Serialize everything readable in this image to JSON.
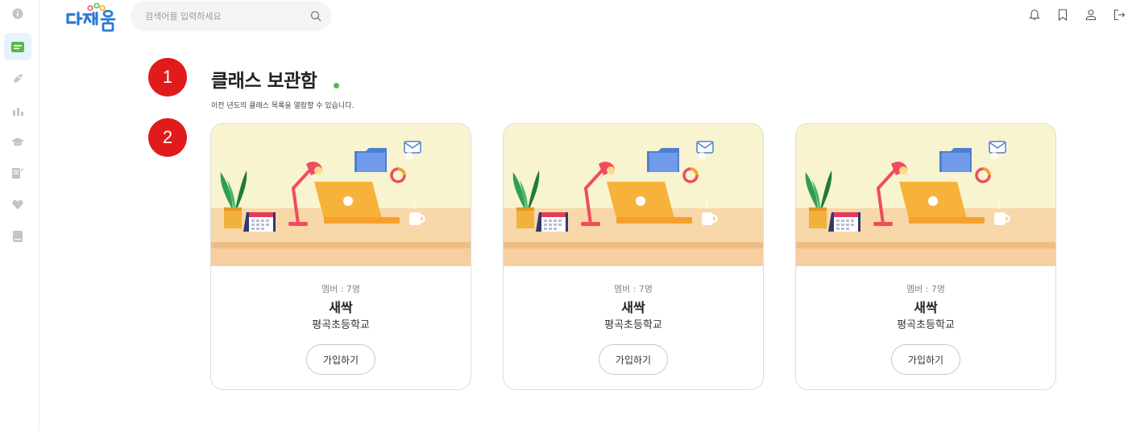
{
  "header": {
    "logo_text": "다채움",
    "search": {
      "placeholder": "검색어를 입력하세요",
      "value": "",
      "icon": "search-icon"
    },
    "icons": [
      "bell-icon",
      "bookmark-icon",
      "user-icon",
      "logout-icon"
    ]
  },
  "sidebar": {
    "items": [
      {
        "icon": "info-icon",
        "active": false
      },
      {
        "icon": "class-card-icon",
        "active": true
      },
      {
        "icon": "rocket-icon",
        "active": false
      },
      {
        "icon": "chart-icon",
        "active": false
      },
      {
        "icon": "graduation-cap-icon",
        "active": false
      },
      {
        "icon": "edit-note-icon",
        "active": false
      },
      {
        "icon": "heart-icon",
        "active": false
      },
      {
        "icon": "book-icon",
        "active": false
      }
    ]
  },
  "markers": [
    "1",
    "2"
  ],
  "page": {
    "title": "클래스 보관함",
    "subtitle": "이전 년도의 클래스 목록을 열람할 수 있습니다."
  },
  "cards": [
    {
      "members": "멤버 : 7명",
      "name": "새싹",
      "school": "평곡초등학교",
      "join_label": "가입하기"
    },
    {
      "members": "멤버 : 7명",
      "name": "새싹",
      "school": "평곡초등학교",
      "join_label": "가입하기"
    },
    {
      "members": "멤버 : 7명",
      "name": "새싹",
      "school": "평곡초등학교",
      "join_label": "가입하기"
    }
  ],
  "colors": {
    "accent_blue": "#2a7bd6",
    "marker_red": "#e11b1b",
    "title_dot_green": "#54b948",
    "illus_wall": "#f8f4cf",
    "illus_desk": "#f8d7a8"
  }
}
